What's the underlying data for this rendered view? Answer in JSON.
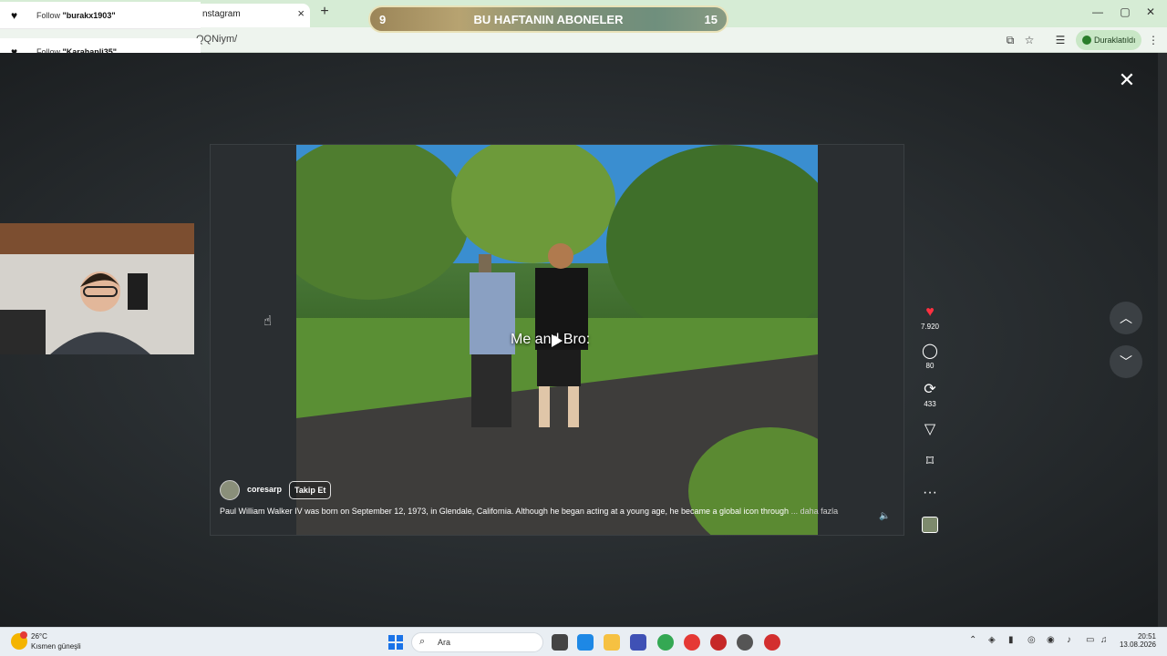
{
  "browser": {
    "tab_title": "nstagram",
    "tab_close": "×",
    "new_tab": "+",
    "url": "QQNiym/",
    "paused_label": "Duraklatıldı",
    "window_controls": [
      "—",
      "▢",
      "✕"
    ]
  },
  "subs_banner": {
    "left_value": "9",
    "title": "BU HAFTANIN ABONELER",
    "right_value": "15"
  },
  "notifications": [
    {
      "prefix": "Follow ",
      "user": "\"burakx1903\""
    },
    {
      "prefix": "Follow ",
      "user": "\"Karahanli35\""
    }
  ],
  "post": {
    "overlay_text": "Me and Bro:",
    "username": "coresarp",
    "follow_label": "Takip Et",
    "description": "Paul William Walker IV was born on September 12, 1973, in Glendale, California. Although he began acting at a young age, he became a global icon through",
    "more_label": "... daha fazla",
    "likes": "7.920",
    "comments": "80",
    "reposts": "433"
  },
  "icons": {
    "close": "✕",
    "like": "♥",
    "comment": "◯",
    "repost": "⟳",
    "share": "▽",
    "save": "⌑",
    "more": "···",
    "mute": "🔈",
    "nav_up": "︿",
    "nav_down": "﹀"
  },
  "taskbar": {
    "weather_temp": "26°C",
    "weather_desc": "Kısmen güneşli",
    "search_placeholder": "Ara",
    "time": "20:51",
    "date": "13.08.2026"
  }
}
